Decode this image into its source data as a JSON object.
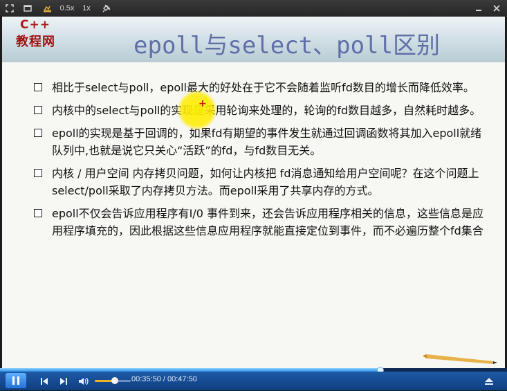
{
  "toolbar": {
    "speed_half": "0.5x",
    "speed_one": "1x"
  },
  "slide": {
    "logo_top": "C++",
    "logo_bottom": "教程网",
    "title": "epoll与select、poll区别",
    "bullets": [
      "相比于select与poll，epoll最大的好处在于它不会随着监听fd数目的增长而降低效率。",
      "内核中的select与poll的实现是采用轮询来处理的，轮询的fd数目越多，自然耗时越多。",
      "epoll的实现是基于回调的，如果fd有期望的事件发生就通过回调函数将其加入epoll就绪队列中,也就是说它只关心“活跃”的fd，与fd数目无关。",
      "内核 / 用户空间 内存拷贝问题，如何让内核把 fd消息通知给用户空间呢？在这个问题上select/poll采取了内存拷贝方法。而epoll采用了共享内存的方式。",
      "epoll不仅会告诉应用程序有I/0 事件到来，还会告诉应用程序相关的信息，这些信息是应用程序填充的，因此根据这些信息应用程序就能直接定位到事件，而不必遍历整个fd集合"
    ]
  },
  "player": {
    "time_display": "00:35:50 / 00:47:50",
    "progress_fraction": 0.749,
    "volume_fraction": 0.55
  },
  "colors": {
    "title": "#5f6fa8",
    "logo": "#b01818",
    "controlbar": "#1e5aa6",
    "progress": "#2f8fe8",
    "volume": "#f2b125"
  },
  "icons": [
    "fullscreen-icon",
    "window-icon",
    "snapshot-icon",
    "pin-icon",
    "minimize-icon",
    "close-icon",
    "play-pause-icon",
    "previous-icon",
    "next-icon",
    "volume-icon",
    "eject-icon"
  ]
}
